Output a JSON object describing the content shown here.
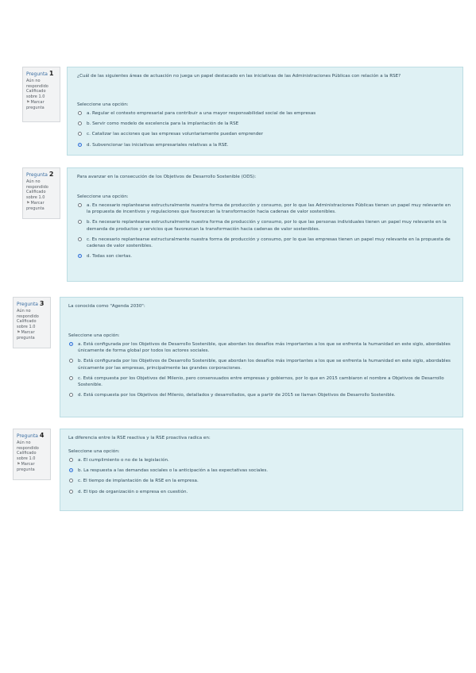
{
  "questions": [
    {
      "label": "Pregunta",
      "number": "1",
      "status": "Aún no respondido",
      "grade": "Calificado sobre 1.0",
      "flag": "Marcar pregunta",
      "text": "¿Cuál de las siguientes áreas de actuación no juega un papel destacado en las iniciativas de las Administraciones Públicas con relación a la RSE?",
      "prompt": "Seleccione una opción:",
      "options": [
        {
          "text": "a. Regular el contexto empresarial para contribuir a una mayor responsabilidad social de las empresas",
          "selected": false
        },
        {
          "text": "b. Servir como modelo de excelencia para la implantación de la RSE",
          "selected": false
        },
        {
          "text": "c. Catalizar las acciones que las empresas voluntariamente puedan emprender",
          "selected": false
        },
        {
          "text": "d. Subvencionar las iniciativas empresariales relativas a la RSE.",
          "selected": true
        }
      ]
    },
    {
      "label": "Pregunta",
      "number": "2",
      "status": "Aún no respondido",
      "grade": "Calificado sobre 1.0",
      "flag": "Marcar pregunta",
      "text": "Para avanzar en la consecución de los Objetivos de Desarrollo Sostenible (ODS):",
      "prompt": "Seleccione una opción:",
      "options": [
        {
          "text": "a. Es necesario replantearse estructuralmente nuestra forma de producción y consumo, por lo que las Administraciones Públicas tienen un papel muy relevante en la propuesta de incentivos y regulaciones que favorezcan la transformación hacia cadenas de valor sostenibles.",
          "selected": false
        },
        {
          "text": "b. Es necesario replantearse estructuralmente nuestra forma de producción y consumo, por lo que las personas individuales tienen un papel muy relevante en la demanda de productos y servicios que favorezcan la transformación hacia cadenas de valor sostenibles.",
          "selected": false
        },
        {
          "text": "c. Es necesario replantearse estructuralmente nuestra forma de producción y consumo, por lo que las empresas tienen un papel muy relevante en la propuesta de cadenas de valor sostenibles.",
          "selected": false
        },
        {
          "text": "d. Todas son ciertas.",
          "selected": true
        }
      ]
    },
    {
      "label": "Pregunta",
      "number": "3",
      "status": "Aún no respondido",
      "grade": "Calificado sobre 1.0",
      "flag": "Marcar pregunta",
      "text": "La conocida como \"Agenda 2030\":",
      "prompt": "Seleccione una opción:",
      "options": [
        {
          "text": "a. Está configurada por los Objetivos de Desarrollo Sostenible, que abordan los desafíos más importantes a los que se enfrenta la humanidad en este siglo, abordables únicamente de forma global por todos los actores sociales.",
          "selected": true
        },
        {
          "text": "b. Está configurada por los Objetivos de Desarrollo Sostenible, que abordan los desafíos más importantes a los que se enfrenta la humanidad en este siglo, abordables únicamente por las empresas, principalmente las grandes corporaciones.",
          "selected": false
        },
        {
          "text": "c. Está compuesta por los Objetivos del Milenio, pero consensuados entre empresas y gobiernos, por lo que en 2015 cambiaron el nombre a Objetivos de Desarrollo Sostenible.",
          "selected": false
        },
        {
          "text": "d. Está compuesta por los Objetivos del Milenio, detallados y desarrollados, que a partir de 2015 se llaman Objetivos de Desarrollo Sostenible.",
          "selected": false
        }
      ]
    },
    {
      "label": "Pregunta",
      "number": "4",
      "status": "Aún no respondido",
      "grade": "Calificado sobre 1.0",
      "flag": "Marcar pregunta",
      "text": "La diferencia entre la RSE reactiva y la RSE proactiva radica en:",
      "prompt": "Seleccione una opción:",
      "options": [
        {
          "text": "a. El cumplimiento o no de la legislación.",
          "selected": false
        },
        {
          "text": "b. La respuesta a las demandas sociales o la anticipación a las expectativas sociales.",
          "selected": true
        },
        {
          "text": "c. El tiempo de implantación de la RSE en la empresa.",
          "selected": false
        },
        {
          "text": "d. El tipo de organización o empresa en cuestión.",
          "selected": false
        }
      ]
    }
  ]
}
